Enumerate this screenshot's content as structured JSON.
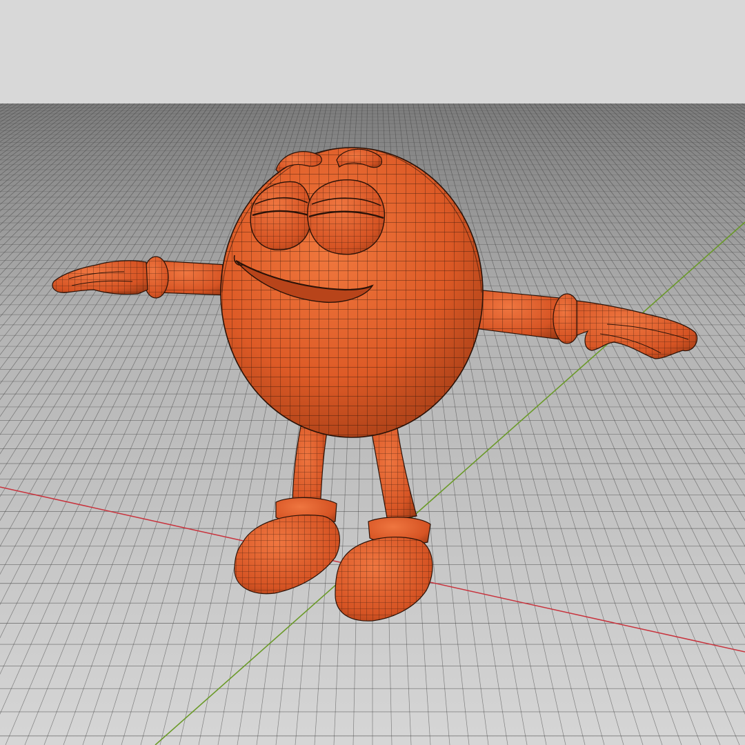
{
  "viewport": {
    "view": "perspective",
    "background": {
      "sky_color": "#d8d8d8",
      "ground_color": "#9a9a9a",
      "floor_color": "#d4d4d4",
      "grid_line_color": "#3c3c3c"
    },
    "axes": {
      "x_axis_color": "#c8323c",
      "y_axis_color": "#6a9a28"
    },
    "model": {
      "name": "",
      "display_mode": "wireframe-on-shaded",
      "material_color": "#e05a28",
      "shade_color": "#b8441a",
      "highlight_color": "#f07a40",
      "wire_color": "#2a1208",
      "pose": "T-pose"
    }
  }
}
